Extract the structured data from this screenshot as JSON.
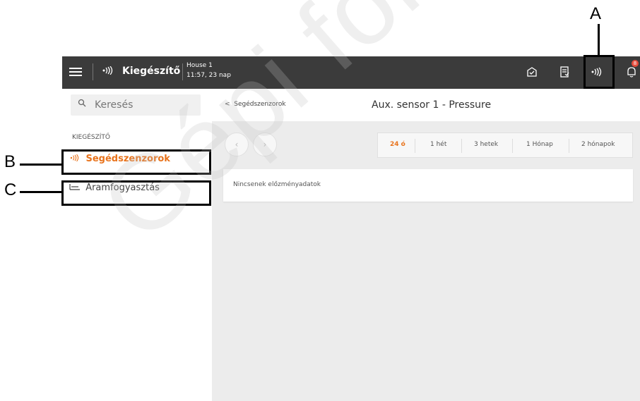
{
  "topbar": {
    "app_title": "Kiegészítő",
    "house_name": "House 1",
    "house_time": "11:57, 23 nap",
    "bell_badge": "8",
    "icons": [
      "menu-icon",
      "sensor-icon",
      "envelope-icon",
      "document-icon",
      "sensor-icon",
      "bell-icon"
    ]
  },
  "sidebar": {
    "search_placeholder": "Keresés",
    "section_label": "KIEGÉSZÍTŐ",
    "items": [
      {
        "label": "Segédszenzorok",
        "active": true,
        "icon": "sensor-icon"
      },
      {
        "label": "Áramfogyasztás",
        "active": false,
        "icon": "meter-icon"
      }
    ]
  },
  "main": {
    "back_label": "Segédszenzorok",
    "title": "Aux. sensor 1 - Pressure",
    "ranges": [
      "24 ó",
      "1 hét",
      "3 hetek",
      "1 Hónap",
      "2 hónapok"
    ],
    "active_range": "24 ó",
    "empty_message": "Nincsenek előzményadatok"
  },
  "callouts": {
    "a": "A",
    "b": "B",
    "c": "C"
  },
  "watermark": "Gépi fordítás",
  "colors": {
    "accent": "#e8731c",
    "topbar_bg": "#3b3b3b",
    "main_bg": "#ececec",
    "badge": "#e74c3c"
  }
}
